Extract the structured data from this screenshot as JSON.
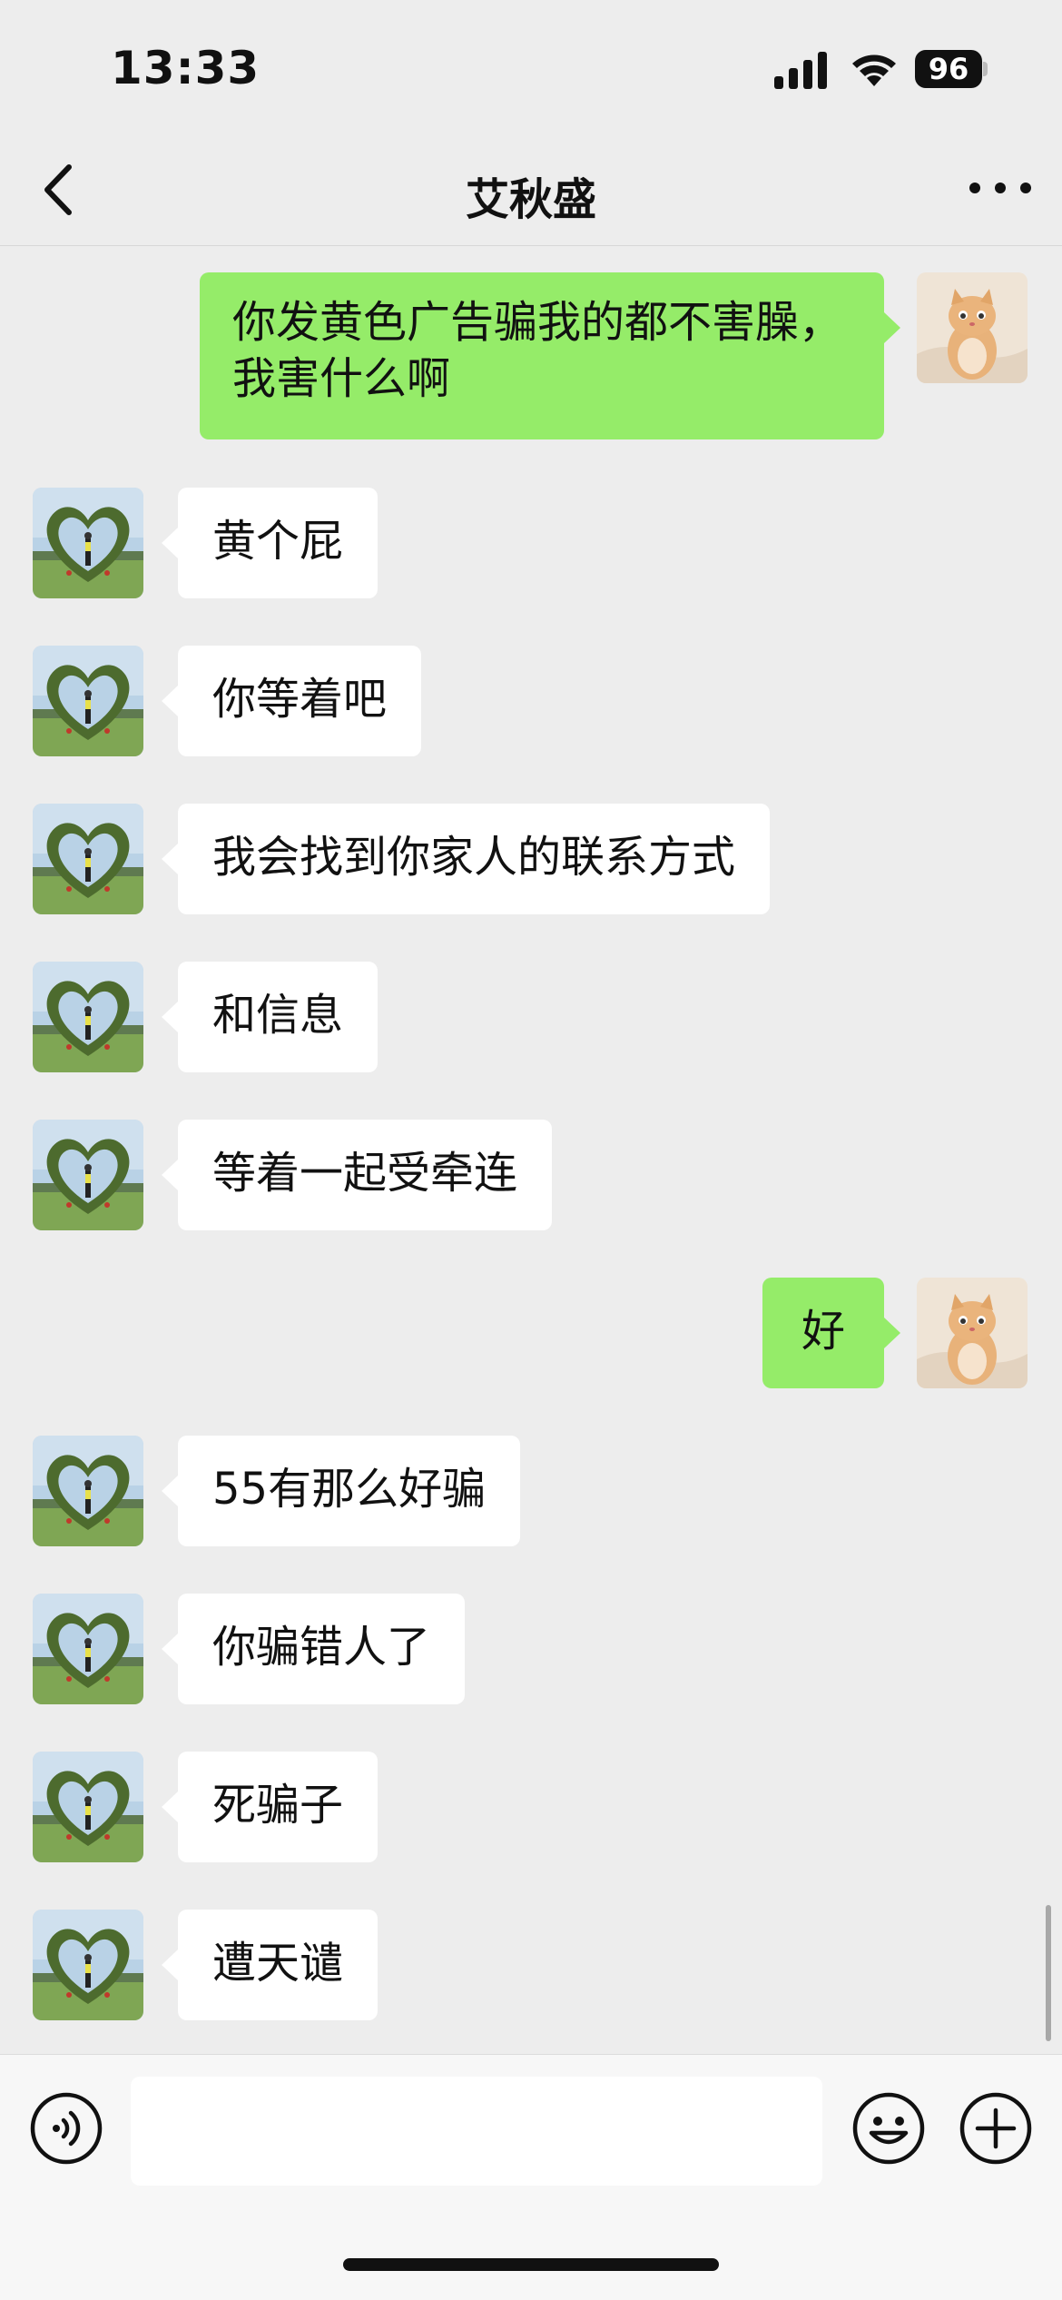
{
  "status_bar": {
    "time": "13:33",
    "battery": "96"
  },
  "nav": {
    "title": "艾秋盛"
  },
  "messages": [
    {
      "side": "out",
      "text": "你发黄色广告骗我的都不害臊，我害什么啊"
    },
    {
      "side": "in",
      "text": "黄个屁"
    },
    {
      "side": "in",
      "text": "你等着吧"
    },
    {
      "side": "in",
      "text": "我会找到你家人的联系方式"
    },
    {
      "side": "in",
      "text": "和信息"
    },
    {
      "side": "in",
      "text": "等着一起受牵连"
    },
    {
      "side": "out",
      "text": "好"
    },
    {
      "side": "in",
      "text": "55有那么好骗"
    },
    {
      "side": "in",
      "text": "你骗错人了"
    },
    {
      "side": "in",
      "text": "死骗子"
    },
    {
      "side": "in",
      "text": "遭天谴"
    }
  ],
  "input": {
    "value": "",
    "placeholder": ""
  },
  "icons": {
    "back": "chevron-left-icon",
    "more": "more-dots-icon",
    "voice": "voice-icon",
    "emoji": "emoji-icon",
    "plus": "plus-icon"
  },
  "colors": {
    "chat_background": "#ededed",
    "outgoing_bubble": "#95ec69",
    "incoming_bubble": "#ffffff"
  }
}
